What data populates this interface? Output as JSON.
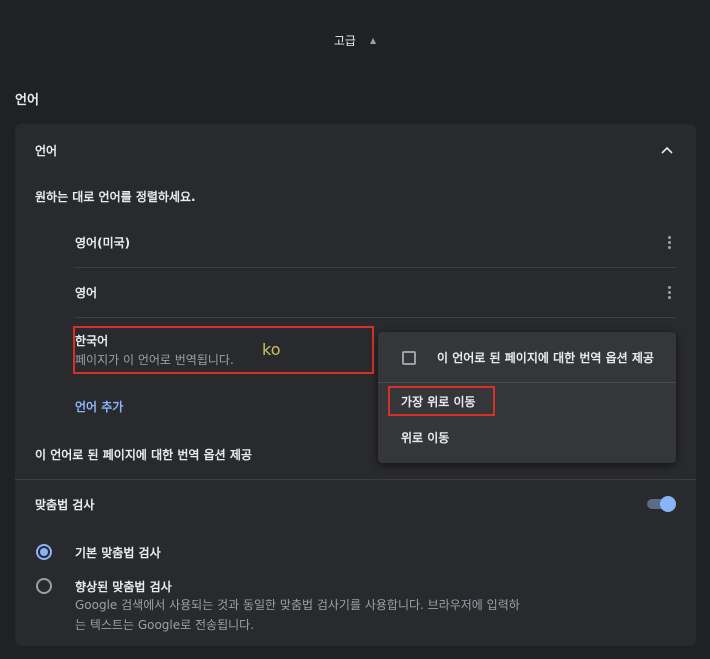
{
  "advanced": {
    "label": "고급",
    "icon": "chevron-up-icon"
  },
  "section_title": "언어",
  "languages_card": {
    "header": "언어",
    "collapse_icon": "chevron-up-icon",
    "description": "원하는 대로 언어를 정렬하세요.",
    "languages": [
      {
        "name": "영어(미국)",
        "menu_icon": "more-vert-icon"
      },
      {
        "name": "영어",
        "menu_icon": "more-vert-icon"
      }
    ],
    "korean": {
      "name": "한국어",
      "subtitle": "페이지가 이 언어로 번역됩니다.",
      "tag": "ko"
    },
    "add_language": "언어 추가",
    "offer_translate": "이 언어로 된 페이지에 대한 번역 옵션 제공"
  },
  "spellcheck": {
    "title": "맞춤법 검사",
    "toggle_on": true,
    "options": [
      {
        "label": "기본 맞춤법 검사",
        "checked": true,
        "subtitle": ""
      },
      {
        "label": "향상된 맞춤법 검사",
        "checked": false,
        "subtitle_line1": "Google 검색에서 사용되는 것과 동일한 맞춤법 검사기를 사용합니다. 브라우저에 입력하",
        "subtitle_line2": "는 텍스트는 Google로 전송됩니다."
      }
    ]
  },
  "context_menu": {
    "checkbox_label": "이 언어로 된 페이지에 대한 번역 옵션 제공",
    "checkbox_checked": false,
    "items": [
      "가장 위로 이동",
      "위로 이동"
    ]
  },
  "colors": {
    "accent": "#8ab4f8",
    "highlight": "#d93025",
    "background": "#202124",
    "card": "#292a2d"
  }
}
